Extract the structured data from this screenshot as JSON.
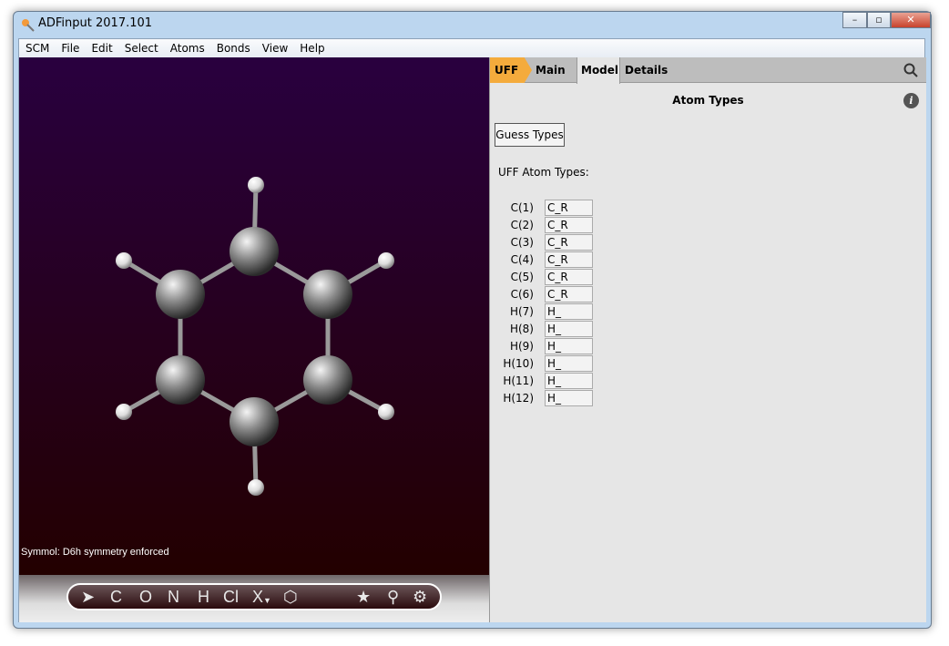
{
  "window": {
    "title": "ADFinput 2017.101",
    "minimize": "–",
    "maximize": "▫",
    "close": "✕"
  },
  "menu": [
    "SCM",
    "File",
    "Edit",
    "Select",
    "Atoms",
    "Bonds",
    "View",
    "Help"
  ],
  "viewer": {
    "status": "Symmol: D6h symmetry enforced",
    "toolbar": [
      "C",
      "O",
      "N",
      "H",
      "Cl",
      "X"
    ],
    "background_top": "#29003f",
    "background_bottom": "#230000"
  },
  "tabs": {
    "uff": "UFF",
    "main": "Main",
    "model": "Model",
    "details": "Details",
    "active": "Model",
    "accent": "#f4ab3c"
  },
  "panel": {
    "heading": "Atom Types",
    "guess_button": "Guess Types",
    "list_label": "UFF Atom Types:",
    "atoms": [
      {
        "name": "C(1)",
        "type": "C_R"
      },
      {
        "name": "C(2)",
        "type": "C_R"
      },
      {
        "name": "C(3)",
        "type": "C_R"
      },
      {
        "name": "C(4)",
        "type": "C_R"
      },
      {
        "name": "C(5)",
        "type": "C_R"
      },
      {
        "name": "C(6)",
        "type": "C_R"
      },
      {
        "name": "H(7)",
        "type": "H_"
      },
      {
        "name": "H(8)",
        "type": "H_"
      },
      {
        "name": "H(9)",
        "type": "H_"
      },
      {
        "name": "H(10)",
        "type": "H_"
      },
      {
        "name": "H(11)",
        "type": "H_"
      },
      {
        "name": "H(12)",
        "type": "H_"
      }
    ]
  }
}
